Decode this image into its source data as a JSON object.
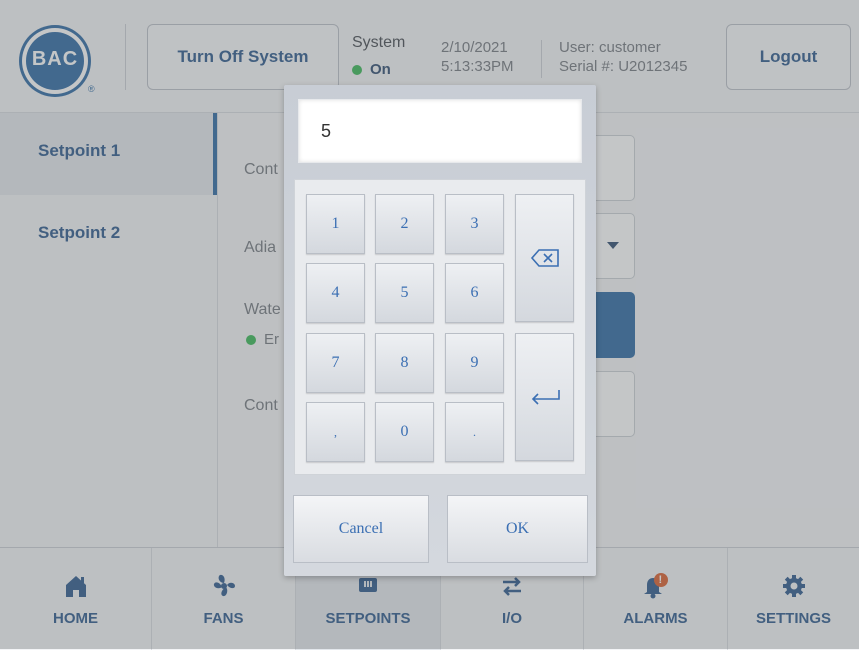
{
  "header": {
    "logo_text": "BAC",
    "logo_registered": "®",
    "turn_off_button": "Turn Off System",
    "system_label": "System",
    "system_status": "On",
    "date": "2/10/2021",
    "time": "5:13:33PM",
    "user": "User: customer",
    "serial": "Serial #: U2012345",
    "logout_button": "Logout",
    "status_color": "#2bb34a",
    "brand_color": "#1f5f9d"
  },
  "sidebar": {
    "items": [
      {
        "label": "Setpoint 1",
        "active": true
      },
      {
        "label": "Setpoint 2",
        "active": false
      }
    ]
  },
  "main": {
    "rows": [
      {
        "label": "Cont"
      },
      {
        "label": "Adia"
      },
      {
        "label": "Wate"
      },
      {
        "label": "Er"
      },
      {
        "label": "Cont"
      }
    ]
  },
  "keypad": {
    "display_value": "5",
    "keys": [
      "1",
      "2",
      "3",
      "4",
      "5",
      "6",
      "7",
      "8",
      "9",
      ",",
      "0",
      "."
    ],
    "backspace_icon": "backspace-icon",
    "enter_icon": "enter-icon",
    "cancel_label": "Cancel",
    "ok_label": "OK"
  },
  "bottom_nav": {
    "items": [
      {
        "label": "HOME",
        "icon": "home-icon",
        "active": false
      },
      {
        "label": "FANS",
        "icon": "fan-icon",
        "active": false
      },
      {
        "label": "SETPOINTS",
        "icon": "setpoints-icon",
        "active": true
      },
      {
        "label": "I/O",
        "icon": "io-arrows-icon",
        "active": false
      },
      {
        "label": "ALARMS",
        "icon": "alarm-bell-icon",
        "active": false
      },
      {
        "label": "SETTINGS",
        "icon": "gear-icon",
        "active": false
      }
    ],
    "alarm_badge": "!"
  }
}
